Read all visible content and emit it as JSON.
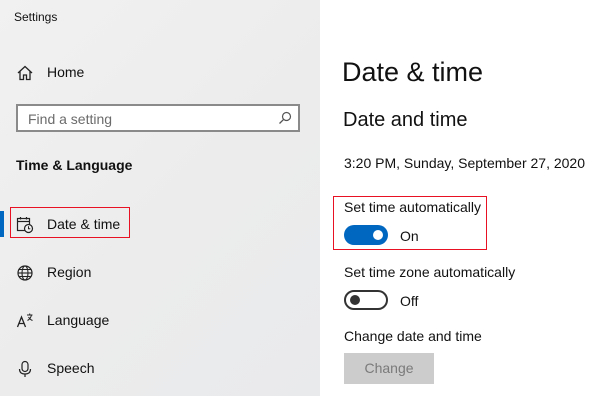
{
  "window": {
    "title": "Settings"
  },
  "sidebar": {
    "home_label": "Home",
    "search": {
      "placeholder": "Find a setting"
    },
    "section_title": "Time & Language",
    "items": [
      {
        "label": "Date & time",
        "icon": "calendar-clock-icon",
        "selected": true
      },
      {
        "label": "Region",
        "icon": "globe-icon"
      },
      {
        "label": "Language",
        "icon": "language-icon"
      },
      {
        "label": "Speech",
        "icon": "microphone-icon"
      }
    ]
  },
  "main": {
    "page_title": "Date & time",
    "section_title": "Date and time",
    "current_datetime": "3:20 PM, Sunday, September 27, 2020",
    "set_time_auto": {
      "label": "Set time automatically",
      "state": "On"
    },
    "set_timezone_auto": {
      "label": "Set time zone automatically",
      "state": "Off"
    },
    "change_section": {
      "label": "Change date and time",
      "button": "Change"
    }
  },
  "colors": {
    "accent": "#0067c0",
    "highlight": "#e81123"
  }
}
